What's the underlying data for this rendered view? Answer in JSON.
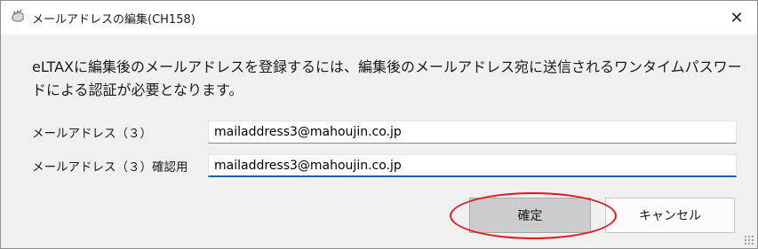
{
  "window": {
    "title": "メールアドレスの編集(CH158)",
    "close_glyph": "✕",
    "icon": "app-icon"
  },
  "message": "eLTAXに編集後のメールアドレスを登録するには、編集後のメールアドレス宛に送信されるワンタイムパスワードによる認証が必要となります。",
  "form": {
    "email_label": "メールアドレス（３）",
    "email_value": "mailaddress3@mahoujin.co.jp",
    "confirm_label": "メールアドレス（３）確認用",
    "confirm_value": "mailaddress3@mahoujin.co.jp"
  },
  "buttons": {
    "ok": "確定",
    "cancel": "キャンセル"
  },
  "colors": {
    "annotation": "#e0171d",
    "focus": "#1a5fb4"
  }
}
